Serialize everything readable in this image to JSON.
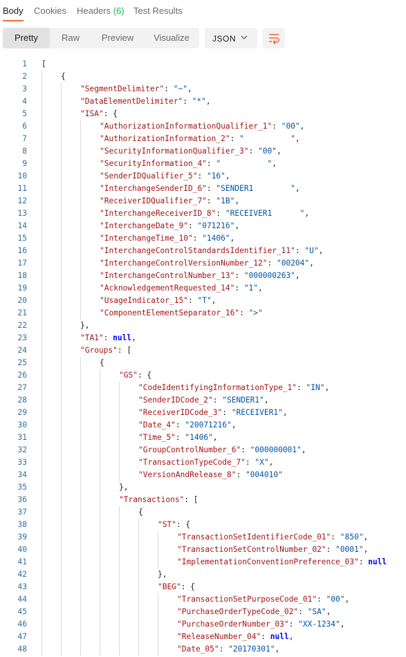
{
  "tabs": [
    {
      "label": "Body",
      "active": true
    },
    {
      "label": "Cookies",
      "active": false
    },
    {
      "label": "Headers",
      "badge": "(6)",
      "active": false
    },
    {
      "label": "Test Results",
      "active": false
    }
  ],
  "view_modes": [
    "Pretty",
    "Raw",
    "Preview",
    "Visualize"
  ],
  "active_view": "Pretty",
  "format": "JSON",
  "icons": {
    "format_dropdown": "chevron-down-icon",
    "wrap": "wrap-lines-icon"
  },
  "colors": {
    "accent": "#f26b3a",
    "key": "#a31515",
    "string": "#0451a5",
    "literal": "#0000ff",
    "line_number": "#2f6f9f",
    "badge": "#0cbb52"
  },
  "code_lines": [
    {
      "n": "1",
      "i": 0,
      "t": [
        [
          "p",
          "["
        ]
      ]
    },
    {
      "n": "2",
      "i": 1,
      "t": [
        [
          "p",
          "{"
        ]
      ]
    },
    {
      "n": "3",
      "i": 2,
      "t": [
        [
          "k",
          "\"SegmentDelimiter\""
        ],
        [
          "p",
          ": "
        ],
        [
          "s",
          "\"~\""
        ],
        [
          "p",
          ","
        ]
      ]
    },
    {
      "n": "4",
      "i": 2,
      "t": [
        [
          "k",
          "\"DataElementDelimiter\""
        ],
        [
          "p",
          ": "
        ],
        [
          "s",
          "\"*\""
        ],
        [
          "p",
          ","
        ]
      ]
    },
    {
      "n": "5",
      "i": 2,
      "t": [
        [
          "k",
          "\"ISA\""
        ],
        [
          "p",
          ": {"
        ]
      ]
    },
    {
      "n": "6",
      "i": 3,
      "t": [
        [
          "k",
          "\"AuthorizationInformationQualifier_1\""
        ],
        [
          "p",
          ": "
        ],
        [
          "s",
          "\"00\""
        ],
        [
          "p",
          ","
        ]
      ]
    },
    {
      "n": "7",
      "i": 3,
      "t": [
        [
          "k",
          "\"AuthorizationInformation_2\""
        ],
        [
          "p",
          ": "
        ],
        [
          "s",
          "\"          \""
        ],
        [
          "p",
          ","
        ]
      ]
    },
    {
      "n": "8",
      "i": 3,
      "t": [
        [
          "k",
          "\"SecurityInformationQualifier_3\""
        ],
        [
          "p",
          ": "
        ],
        [
          "s",
          "\"00\""
        ],
        [
          "p",
          ","
        ]
      ]
    },
    {
      "n": "9",
      "i": 3,
      "t": [
        [
          "k",
          "\"SecurityInformation_4\""
        ],
        [
          "p",
          ": "
        ],
        [
          "s",
          "\"          \""
        ],
        [
          "p",
          ","
        ]
      ]
    },
    {
      "n": "10",
      "i": 3,
      "t": [
        [
          "k",
          "\"SenderIDQualifier_5\""
        ],
        [
          "p",
          ": "
        ],
        [
          "s",
          "\"16\""
        ],
        [
          "p",
          ","
        ]
      ]
    },
    {
      "n": "11",
      "i": 3,
      "t": [
        [
          "k",
          "\"InterchangeSenderID_6\""
        ],
        [
          "p",
          ": "
        ],
        [
          "s",
          "\"SENDER1        \""
        ],
        [
          "p",
          ","
        ]
      ]
    },
    {
      "n": "12",
      "i": 3,
      "t": [
        [
          "k",
          "\"ReceiverIDQualifier_7\""
        ],
        [
          "p",
          ": "
        ],
        [
          "s",
          "\"1B\""
        ],
        [
          "p",
          ","
        ]
      ]
    },
    {
      "n": "13",
      "i": 3,
      "t": [
        [
          "k",
          "\"InterchangeReceiverID_8\""
        ],
        [
          "p",
          ": "
        ],
        [
          "s",
          "\"RECEIVER1      \""
        ],
        [
          "p",
          ","
        ]
      ]
    },
    {
      "n": "14",
      "i": 3,
      "t": [
        [
          "k",
          "\"InterchangeDate_9\""
        ],
        [
          "p",
          ": "
        ],
        [
          "s",
          "\"071216\""
        ],
        [
          "p",
          ","
        ]
      ]
    },
    {
      "n": "15",
      "i": 3,
      "t": [
        [
          "k",
          "\"InterchangeTime_10\""
        ],
        [
          "p",
          ": "
        ],
        [
          "s",
          "\"1406\""
        ],
        [
          "p",
          ","
        ]
      ]
    },
    {
      "n": "16",
      "i": 3,
      "t": [
        [
          "k",
          "\"InterchangeControlStandardsIdentifier_11\""
        ],
        [
          "p",
          ": "
        ],
        [
          "s",
          "\"U\""
        ],
        [
          "p",
          ","
        ]
      ]
    },
    {
      "n": "17",
      "i": 3,
      "t": [
        [
          "k",
          "\"InterchangeControlVersionNumber_12\""
        ],
        [
          "p",
          ": "
        ],
        [
          "s",
          "\"00204\""
        ],
        [
          "p",
          ","
        ]
      ]
    },
    {
      "n": "18",
      "i": 3,
      "t": [
        [
          "k",
          "\"InterchangeControlNumber_13\""
        ],
        [
          "p",
          ": "
        ],
        [
          "s",
          "\"000000263\""
        ],
        [
          "p",
          ","
        ]
      ]
    },
    {
      "n": "19",
      "i": 3,
      "t": [
        [
          "k",
          "\"AcknowledgementRequested_14\""
        ],
        [
          "p",
          ": "
        ],
        [
          "s",
          "\"1\""
        ],
        [
          "p",
          ","
        ]
      ]
    },
    {
      "n": "20",
      "i": 3,
      "t": [
        [
          "k",
          "\"UsageIndicator_15\""
        ],
        [
          "p",
          ": "
        ],
        [
          "s",
          "\"T\""
        ],
        [
          "p",
          ","
        ]
      ]
    },
    {
      "n": "21",
      "i": 3,
      "t": [
        [
          "k",
          "\"ComponentElementSeparator_16\""
        ],
        [
          "p",
          ": "
        ],
        [
          "s",
          "\">\""
        ]
      ]
    },
    {
      "n": "22",
      "i": 2,
      "t": [
        [
          "p",
          "},"
        ]
      ]
    },
    {
      "n": "23",
      "i": 2,
      "t": [
        [
          "k",
          "\"TA1\""
        ],
        [
          "p",
          ": "
        ],
        [
          "n",
          "null"
        ],
        [
          "p",
          ","
        ]
      ]
    },
    {
      "n": "24",
      "i": 2,
      "t": [
        [
          "k",
          "\"Groups\""
        ],
        [
          "p",
          ": ["
        ]
      ]
    },
    {
      "n": "25",
      "i": 3,
      "t": [
        [
          "p",
          "{"
        ]
      ]
    },
    {
      "n": "26",
      "i": 4,
      "t": [
        [
          "k",
          "\"GS\""
        ],
        [
          "p",
          ": {"
        ]
      ]
    },
    {
      "n": "27",
      "i": 5,
      "t": [
        [
          "k",
          "\"CodeIdentifyingInformationType_1\""
        ],
        [
          "p",
          ": "
        ],
        [
          "s",
          "\"IN\""
        ],
        [
          "p",
          ","
        ]
      ]
    },
    {
      "n": "28",
      "i": 5,
      "t": [
        [
          "k",
          "\"SenderIDCode_2\""
        ],
        [
          "p",
          ": "
        ],
        [
          "s",
          "\"SENDER1\""
        ],
        [
          "p",
          ","
        ]
      ]
    },
    {
      "n": "29",
      "i": 5,
      "t": [
        [
          "k",
          "\"ReceiverIDCode_3\""
        ],
        [
          "p",
          ": "
        ],
        [
          "s",
          "\"RECEIVER1\""
        ],
        [
          "p",
          ","
        ]
      ]
    },
    {
      "n": "30",
      "i": 5,
      "t": [
        [
          "k",
          "\"Date_4\""
        ],
        [
          "p",
          ": "
        ],
        [
          "s",
          "\"20071216\""
        ],
        [
          "p",
          ","
        ]
      ]
    },
    {
      "n": "31",
      "i": 5,
      "t": [
        [
          "k",
          "\"Time_5\""
        ],
        [
          "p",
          ": "
        ],
        [
          "s",
          "\"1406\""
        ],
        [
          "p",
          ","
        ]
      ]
    },
    {
      "n": "32",
      "i": 5,
      "t": [
        [
          "k",
          "\"GroupControlNumber_6\""
        ],
        [
          "p",
          ": "
        ],
        [
          "s",
          "\"000000001\""
        ],
        [
          "p",
          ","
        ]
      ]
    },
    {
      "n": "33",
      "i": 5,
      "t": [
        [
          "k",
          "\"TransactionTypeCode_7\""
        ],
        [
          "p",
          ": "
        ],
        [
          "s",
          "\"X\""
        ],
        [
          "p",
          ","
        ]
      ]
    },
    {
      "n": "34",
      "i": 5,
      "t": [
        [
          "k",
          "\"VersionAndRelease_8\""
        ],
        [
          "p",
          ": "
        ],
        [
          "s",
          "\"004010\""
        ]
      ]
    },
    {
      "n": "35",
      "i": 4,
      "t": [
        [
          "p",
          "},"
        ]
      ]
    },
    {
      "n": "36",
      "i": 4,
      "t": [
        [
          "k",
          "\"Transactions\""
        ],
        [
          "p",
          ": ["
        ]
      ]
    },
    {
      "n": "37",
      "i": 5,
      "t": [
        [
          "p",
          "{"
        ]
      ]
    },
    {
      "n": "38",
      "i": 6,
      "t": [
        [
          "k",
          "\"ST\""
        ],
        [
          "p",
          ": {"
        ]
      ]
    },
    {
      "n": "39",
      "i": 7,
      "t": [
        [
          "k",
          "\"TransactionSetIdentifierCode_01\""
        ],
        [
          "p",
          ": "
        ],
        [
          "s",
          "\"850\""
        ],
        [
          "p",
          ","
        ]
      ]
    },
    {
      "n": "40",
      "i": 7,
      "t": [
        [
          "k",
          "\"TransactionSetControlNumber_02\""
        ],
        [
          "p",
          ": "
        ],
        [
          "s",
          "\"0001\""
        ],
        [
          "p",
          ","
        ]
      ]
    },
    {
      "n": "41",
      "i": 7,
      "t": [
        [
          "k",
          "\"ImplementationConventionPreference_03\""
        ],
        [
          "p",
          ": "
        ],
        [
          "n",
          "null"
        ]
      ]
    },
    {
      "n": "42",
      "i": 6,
      "t": [
        [
          "p",
          "},"
        ]
      ]
    },
    {
      "n": "43",
      "i": 6,
      "t": [
        [
          "k",
          "\"BEG\""
        ],
        [
          "p",
          ": {"
        ]
      ]
    },
    {
      "n": "44",
      "i": 7,
      "t": [
        [
          "k",
          "\"TransactionSetPurposeCode_01\""
        ],
        [
          "p",
          ": "
        ],
        [
          "s",
          "\"00\""
        ],
        [
          "p",
          ","
        ]
      ]
    },
    {
      "n": "45",
      "i": 7,
      "t": [
        [
          "k",
          "\"PurchaseOrderTypeCode_02\""
        ],
        [
          "p",
          ": "
        ],
        [
          "s",
          "\"SA\""
        ],
        [
          "p",
          ","
        ]
      ]
    },
    {
      "n": "46",
      "i": 7,
      "t": [
        [
          "k",
          "\"PurchaseOrderNumber_03\""
        ],
        [
          "p",
          ": "
        ],
        [
          "s",
          "\"XX-1234\""
        ],
        [
          "p",
          ","
        ]
      ]
    },
    {
      "n": "47",
      "i": 7,
      "t": [
        [
          "k",
          "\"ReleaseNumber_04\""
        ],
        [
          "p",
          ": "
        ],
        [
          "n",
          "null"
        ],
        [
          "p",
          ","
        ]
      ]
    },
    {
      "n": "48",
      "i": 7,
      "t": [
        [
          "k",
          "\"Date_05\""
        ],
        [
          "p",
          ": "
        ],
        [
          "s",
          "\"20170301\""
        ],
        [
          "p",
          ","
        ]
      ]
    }
  ]
}
